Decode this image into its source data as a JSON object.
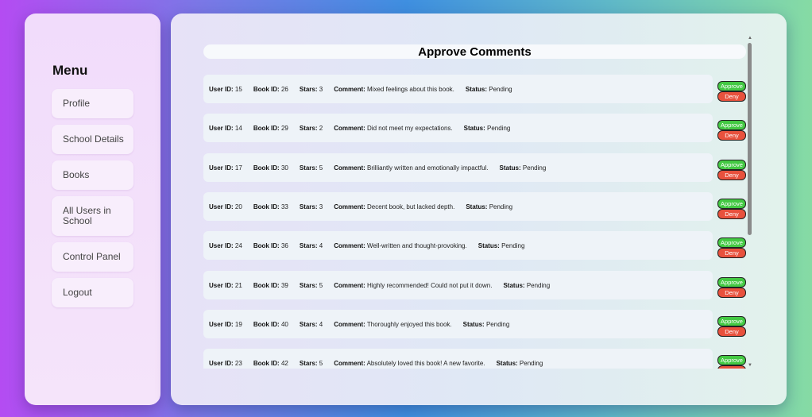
{
  "sidebar": {
    "title": "Menu",
    "items": [
      {
        "label": "Profile"
      },
      {
        "label": "School Details"
      },
      {
        "label": "Books"
      },
      {
        "label": "All Users in School"
      },
      {
        "label": "Control Panel"
      },
      {
        "label": "Logout"
      }
    ]
  },
  "main": {
    "title": "Approve Comments",
    "field_labels": {
      "user_id": "User ID:",
      "book_id": "Book ID:",
      "stars": "Stars:",
      "comment": "Comment:",
      "status": "Status:"
    },
    "approve_label": "Approve",
    "deny_label": "Deny",
    "comments": [
      {
        "user_id": "15",
        "book_id": "26",
        "stars": "3",
        "comment": "Mixed feelings about this book.",
        "status": "Pending"
      },
      {
        "user_id": "14",
        "book_id": "29",
        "stars": "2",
        "comment": "Did not meet my expectations.",
        "status": "Pending"
      },
      {
        "user_id": "17",
        "book_id": "30",
        "stars": "5",
        "comment": "Brilliantly written and emotionally impactful.",
        "status": "Pending"
      },
      {
        "user_id": "20",
        "book_id": "33",
        "stars": "3",
        "comment": "Decent book, but lacked depth.",
        "status": "Pending"
      },
      {
        "user_id": "24",
        "book_id": "36",
        "stars": "4",
        "comment": "Well-written and thought-provoking.",
        "status": "Pending"
      },
      {
        "user_id": "21",
        "book_id": "39",
        "stars": "5",
        "comment": "Highly recommended! Could not put it down.",
        "status": "Pending"
      },
      {
        "user_id": "19",
        "book_id": "40",
        "stars": "4",
        "comment": "Thoroughly enjoyed this book.",
        "status": "Pending"
      },
      {
        "user_id": "23",
        "book_id": "42",
        "stars": "5",
        "comment": "Absolutely loved this book! A new favorite.",
        "status": "Pending"
      }
    ]
  },
  "colors": {
    "approve": "#43c943",
    "deny": "#e8513d"
  },
  "icons": {
    "scroll_up": "scroll-up-arrow-icon",
    "scroll_down": "scroll-down-arrow-icon"
  }
}
